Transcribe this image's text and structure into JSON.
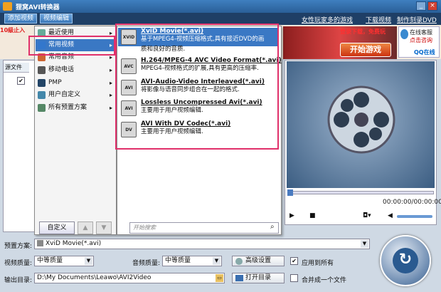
{
  "app": {
    "title": "狸窝AVI转换器",
    "min": "_",
    "close": "×"
  },
  "topbar": {
    "tab_add": "添加视频",
    "tab_edit": "视频编辑",
    "link_games": "女性玩家多的游戏",
    "link_download": "下载视频",
    "link_dvd": "制作刻录DVD"
  },
  "ad": {
    "left_text": "10級止入",
    "right_text": "登录下载，免费玩",
    "play_btn": "开始游戏",
    "qq_l1": "在线客服",
    "qq_l2": "点击咨询",
    "qq_l3": "QQ在线"
  },
  "file_list": {
    "col_header": "源文件"
  },
  "preset_menu": {
    "items": [
      {
        "label": "最近使用",
        "arrow": "▸"
      },
      {
        "label": "常用视频",
        "arrow": "▸"
      },
      {
        "label": "常用音频",
        "arrow": "▸"
      },
      {
        "label": "移动电话",
        "arrow": "▸"
      },
      {
        "label": "PMP",
        "arrow": "▸"
      },
      {
        "label": "用户自定义",
        "arrow": "▸"
      },
      {
        "label": "所有预置方案",
        "arrow": "▸"
      }
    ],
    "custom_btn": "自定义",
    "up_btn": "▲",
    "down_btn": "▼"
  },
  "formats": [
    {
      "icon": "XVID",
      "name": "XviD Movie(*.avi)",
      "desc1": "基于MPEG4-视频压缩格式,具有接近DVD的画",
      "desc2": "质和良好的音质."
    },
    {
      "icon": "AVC",
      "name": "H.264/MPEG-4 AVC Video Format(*.avi)",
      "desc1": "MPEG4-视频格式的扩展,具有更高的压缩率.",
      "desc2": ""
    },
    {
      "icon": "AVI",
      "name": "AVI-Audio-Video Interleaved(*.avi)",
      "desc1": "将影像与语音同步组合在一起的格式.",
      "desc2": ""
    },
    {
      "icon": "AVI",
      "name": "Lossless Uncompressed Avi(*.avi)",
      "desc1": "主要用于用户视频编辑.",
      "desc2": ""
    },
    {
      "icon": "DV",
      "name": "AVI With DV Codec(*.avi)",
      "desc1": "主要用于用户视频编辑.",
      "desc2": ""
    }
  ],
  "search": {
    "placeholder": "开始搜索"
  },
  "preview": {
    "time": "00:00:00/00:00:00"
  },
  "bottom": {
    "preset_label": "预置方案:",
    "preset_value": "XviD Movie(*.avi)",
    "video_quality_label": "视频质量:",
    "video_quality": "中等质量",
    "audio_quality_label": "音频质量:",
    "audio_quality": "中等质量",
    "advanced_btn": "高级设置",
    "apply_all": "应用到所有",
    "output_label": "输出目录:",
    "output_path": "D:\\My Documents\\Leawo\\AVI2Video",
    "open_dir_btn": "打开目录",
    "merge": "合并成一个文件"
  },
  "colors": {
    "accent": "#3a78c4",
    "highlight": "#e0306a"
  }
}
